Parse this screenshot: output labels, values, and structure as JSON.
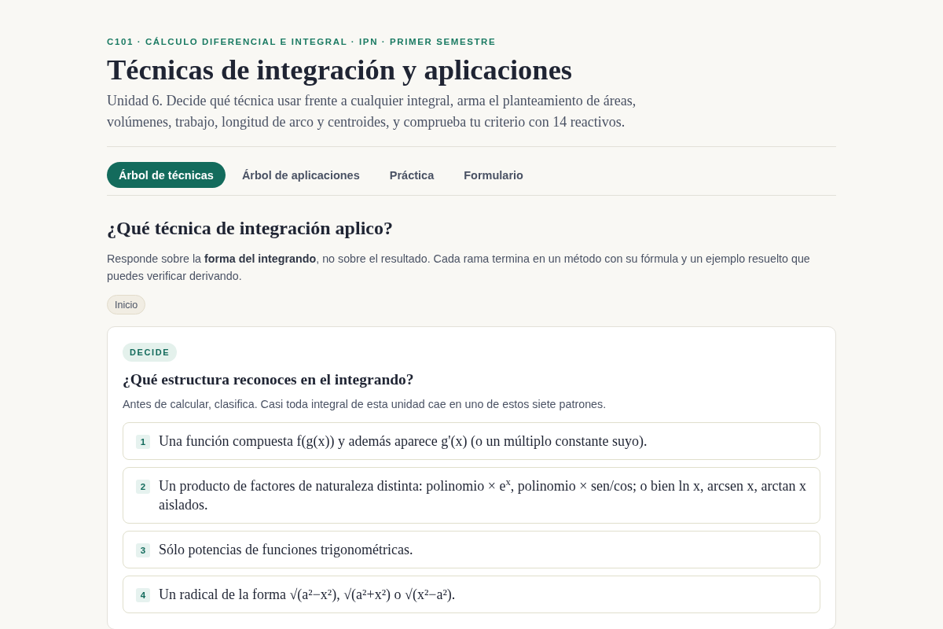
{
  "header": {
    "eyebrow": "C101 · CÁLCULO DIFERENCIAL E INTEGRAL · IPN · PRIMER SEMESTRE",
    "title": "Técnicas de integración y aplicaciones",
    "subtitle": "Unidad 6. Decide qué técnica usar frente a cualquier integral, arma el planteamiento de áreas, volúmenes, trabajo, longitud de arco y centroides, y comprueba tu criterio con 14 reactivos."
  },
  "tabs": [
    {
      "label": "Árbol de técnicas",
      "selected": true
    },
    {
      "label": "Árbol de aplicaciones",
      "selected": false
    },
    {
      "label": "Práctica",
      "selected": false
    },
    {
      "label": "Formulario",
      "selected": false
    }
  ],
  "section": {
    "title": "¿Qué técnica de integración aplico?",
    "intro": "Responde sobre la **forma del integrando**, no sobre el resultado. Cada rama termina en un método con su fórmula y un ejemplo resuelto que puedes verificar derivando."
  },
  "breadcrumb": [
    "Inicio"
  ],
  "question_card": {
    "badge": "DECIDE",
    "question": "¿Qué estructura reconoces en el integrando?",
    "hint": "Antes de calcular, clasifica. Casi toda integral de esta unidad cae en uno de estos siete patrones.",
    "options": [
      {
        "number": "1",
        "text": "Una función compuesta f(g(x)) y además aparece g'(x) (o un múltiplo constante suyo)."
      },
      {
        "number": "2",
        "text": "Un producto de factores de naturaleza distinta: polinomio × e$^{x}$, polinomio × sen/cos; o bien ln x, arcsen x, arctan x aislados."
      },
      {
        "number": "3",
        "text": "Sólo potencias de funciones trigonométricas."
      },
      {
        "number": "4",
        "text": "Un radical de la forma √(a²−x²), √(a²+x²) o √(x²−a²)."
      }
    ]
  }
}
